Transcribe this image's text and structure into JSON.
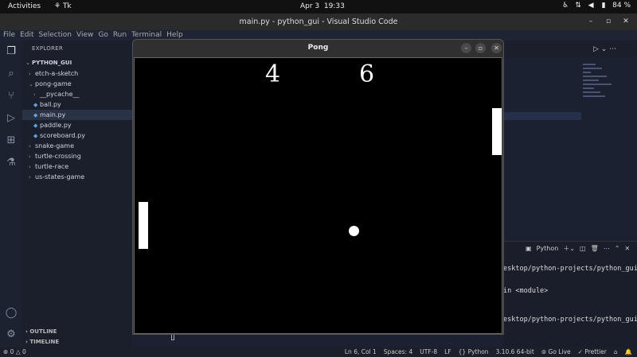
{
  "topbar": {
    "activities": "Activities",
    "app": "Tk",
    "date": "Apr 3",
    "time": "19:33",
    "battery": "84 %"
  },
  "vscode": {
    "title": "main.py - python_gui - Visual Studio Code",
    "menu": [
      "File",
      "Edit",
      "Selection",
      "View",
      "Go",
      "Run",
      "Terminal",
      "Help"
    ],
    "explorer_header": "EXPLORER",
    "root": "PYTHON_GUI",
    "tree": [
      {
        "label": "etch-a-sketch",
        "kind": "folder"
      },
      {
        "label": "pong-game",
        "kind": "folder-open"
      },
      {
        "label": "__pycache__",
        "kind": "folder"
      },
      {
        "label": "ball.py",
        "kind": "py"
      },
      {
        "label": "main.py",
        "kind": "py"
      },
      {
        "label": "paddle.py",
        "kind": "py"
      },
      {
        "label": "scoreboard.py",
        "kind": "py"
      },
      {
        "label": "snake-game",
        "kind": "folder"
      },
      {
        "label": "turtle-crossing",
        "kind": "folder"
      },
      {
        "label": "turtle-race",
        "kind": "folder"
      },
      {
        "label": "us-states-game",
        "kind": "folder"
      }
    ],
    "outline": "OUTLINE",
    "timeline": "TIMELINE",
    "terminal": {
      "shell": "Python",
      "lines": [
        "esktop/python-projects/python_gui",
        "in <module>",
        "esktop/python-projects/python_gui"
      ]
    },
    "status": {
      "errors": "0",
      "warnings": "0",
      "position": "Ln 6, Col 1",
      "spaces": "Spaces: 4",
      "encoding": "UTF-8",
      "eol": "LF",
      "language": "Python",
      "interpreter": "3.10.6 64-bit",
      "golive": "Go Live",
      "prettier": "Prettier"
    }
  },
  "pong": {
    "title": "Pong",
    "score_left": "4",
    "score_right": "6"
  }
}
